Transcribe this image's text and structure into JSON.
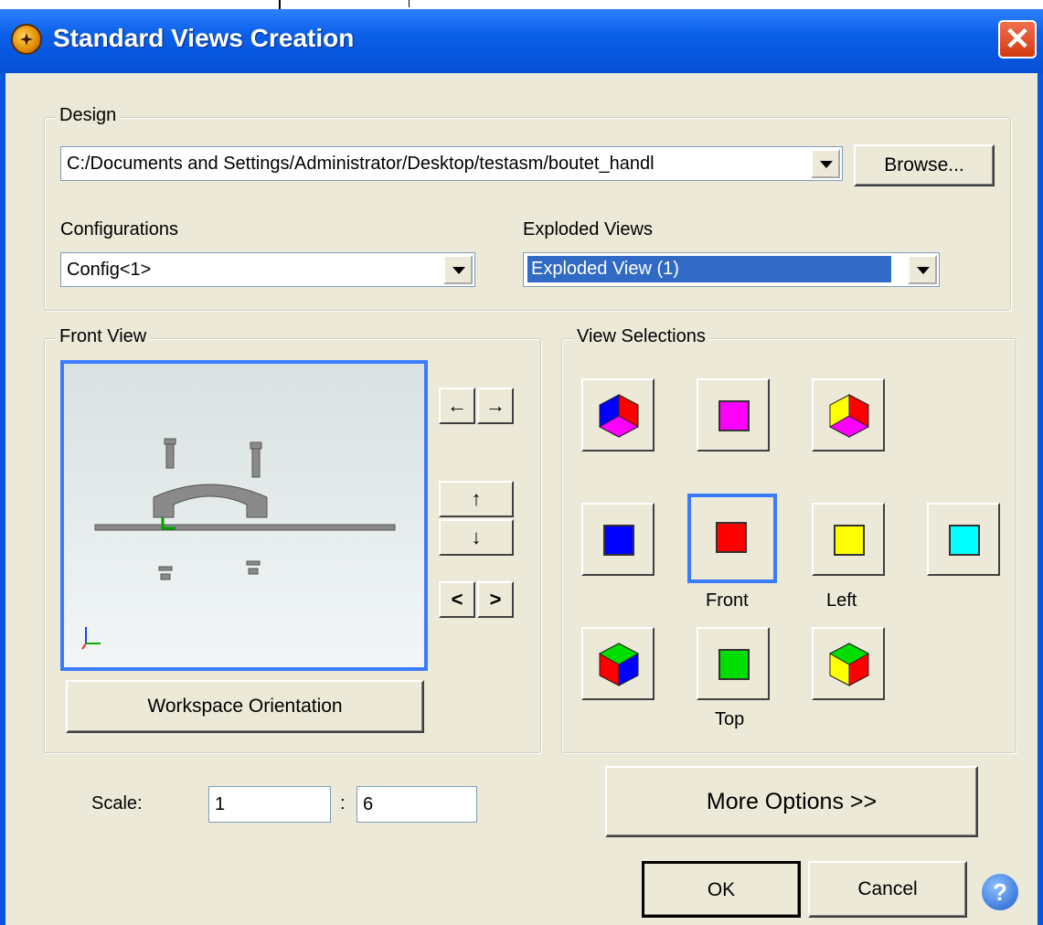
{
  "window": {
    "title": "Standard Views Creation",
    "close_label": "✕"
  },
  "design": {
    "legend": "Design",
    "path": "C:/Documents and Settings/Administrator/Desktop/testasm/boutet_handl",
    "browse_label": "Browse...",
    "configurations_label": "Configurations",
    "configurations_value": "Config<1>",
    "exploded_label": "Exploded Views",
    "exploded_value": "Exploded View (1)"
  },
  "front_view": {
    "legend": "Front View",
    "workspace_label": "Workspace Orientation",
    "nav": {
      "left": "←",
      "right": "→",
      "up": "↑",
      "down": "↓",
      "rotate_left": "<",
      "rotate_right": ">"
    }
  },
  "view_selections": {
    "legend": "View Selections",
    "labels": {
      "front": "Front",
      "left": "Left",
      "top": "Top"
    },
    "colors": {
      "back": "#0000ff",
      "front": "#ff0000",
      "left": "#ffff00",
      "right": "#00ffff",
      "top": "#00dd00",
      "bottom": "#ff00ff"
    }
  },
  "scale": {
    "label": "Scale:",
    "numerator": "1",
    "separator": ":",
    "denominator": "6"
  },
  "actions": {
    "more_options": "More Options  >>",
    "ok": "OK",
    "cancel": "Cancel",
    "help": "?"
  }
}
